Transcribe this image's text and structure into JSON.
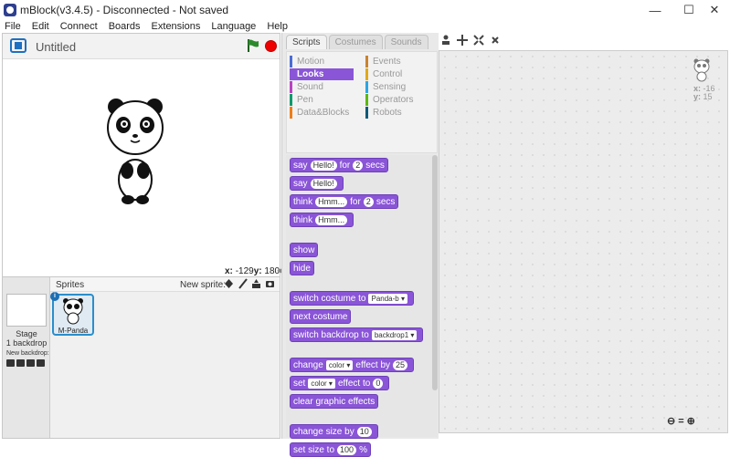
{
  "window": {
    "title": "mBlock(v3.4.5) - Disconnected - Not saved",
    "minimize": "—",
    "maximize": "☐",
    "close": "✕"
  },
  "menu": [
    "File",
    "Edit",
    "Connect",
    "Boards",
    "Extensions",
    "Language",
    "Help"
  ],
  "stage": {
    "project_title": "Untitled",
    "coord_x_label": "x:",
    "coord_x": "-129",
    "coord_y_label": "y:",
    "coord_y": "180"
  },
  "sprites": {
    "header": "Sprites",
    "new_sprite": "New sprite:",
    "stage_label": "Stage",
    "stage_backdrops": "1 backdrop",
    "new_backdrop": "New backdrop:",
    "items": [
      {
        "name": "M-Panda",
        "info": "i"
      }
    ]
  },
  "tabs": [
    {
      "label": "Scripts",
      "active": true
    },
    {
      "label": "Costumes",
      "active": false
    },
    {
      "label": "Sounds",
      "active": false
    }
  ],
  "categories": [
    {
      "label": "Motion",
      "color": "#4a6cd4"
    },
    {
      "label": "Looks",
      "color": "#8a55d7",
      "active": true
    },
    {
      "label": "Sound",
      "color": "#bb42c3"
    },
    {
      "label": "Pen",
      "color": "#0e9a6c"
    },
    {
      "label": "Data&Blocks",
      "color": "#ee7d16"
    },
    {
      "label": "Events",
      "color": "#c88330"
    },
    {
      "label": "Control",
      "color": "#e1a91a"
    },
    {
      "label": "Sensing",
      "color": "#2ca5e2"
    },
    {
      "label": "Operators",
      "color": "#5cb712"
    },
    {
      "label": "Robots",
      "color": "#0e5a7a"
    }
  ],
  "blocks": {
    "say_for": {
      "word1": "say",
      "input1": "Hello!",
      "word2": "for",
      "input2": "2",
      "word3": "secs"
    },
    "say": {
      "word1": "say",
      "input1": "Hello!"
    },
    "think_for": {
      "word1": "think",
      "input1": "Hmm...",
      "word2": "for",
      "input2": "2",
      "word3": "secs"
    },
    "think": {
      "word1": "think",
      "input1": "Hmm..."
    },
    "show": "show",
    "hide": "hide",
    "switch_costume": {
      "word1": "switch costume to",
      "dropdown": "Panda-b"
    },
    "next_costume": "next costume",
    "switch_backdrop": {
      "word1": "switch backdrop to",
      "dropdown": "backdrop1"
    },
    "change_effect": {
      "word1": "change",
      "dropdown": "color",
      "word2": "effect by",
      "input": "25"
    },
    "set_effect": {
      "word1": "set",
      "dropdown": "color",
      "word2": "effect to",
      "input": "0"
    },
    "clear_effects": "clear graphic effects",
    "change_size": {
      "word1": "change size by",
      "input": "10"
    },
    "set_size": {
      "word1": "set size to",
      "input": "100",
      "word2": "%"
    }
  },
  "script_area": {
    "x_label": "x:",
    "x": "-16",
    "y_label": "y:",
    "y": "15"
  },
  "zoom": {
    "out": "⊖",
    "reset": "=",
    "in": "⊕"
  }
}
